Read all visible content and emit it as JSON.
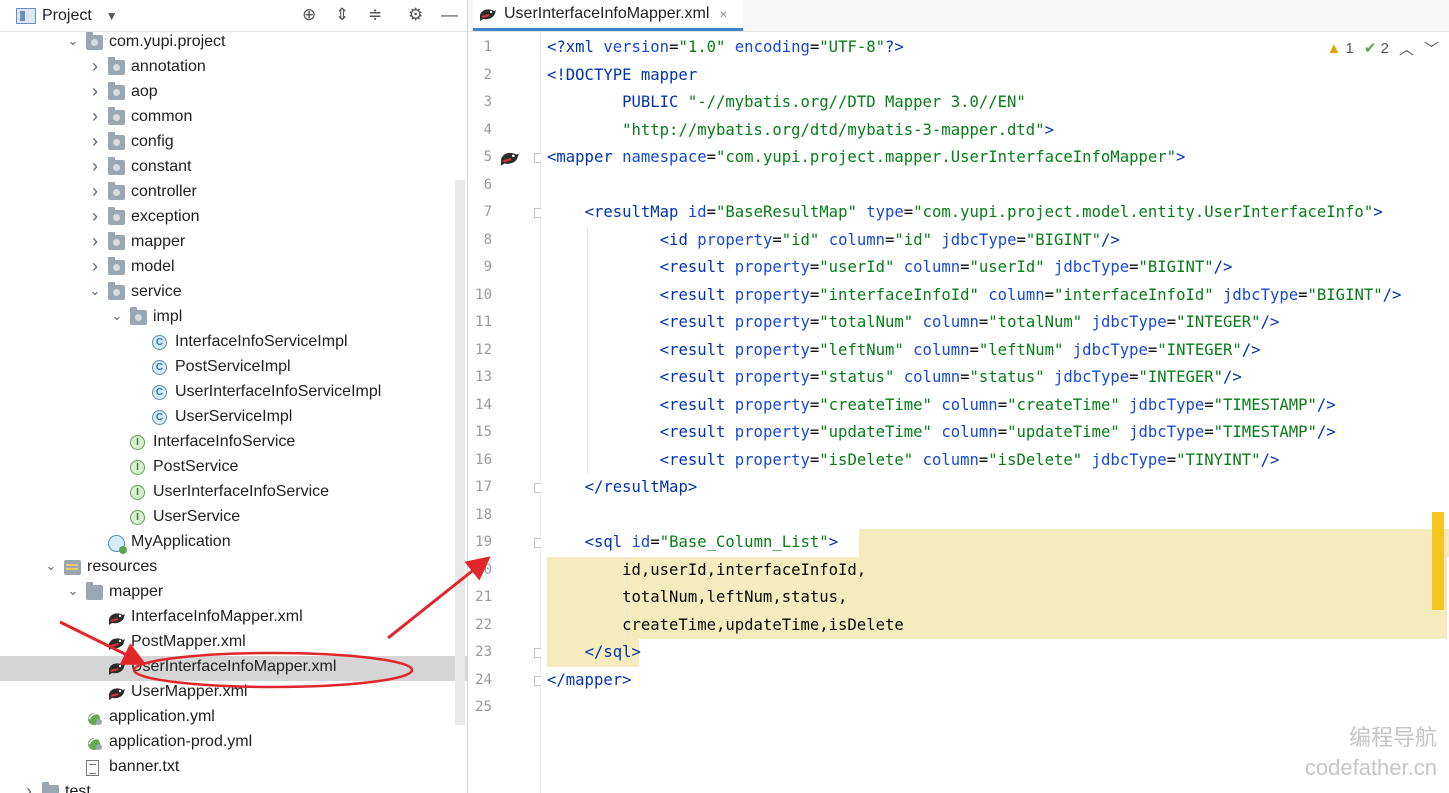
{
  "project_panel": {
    "title": "Project",
    "tree": [
      {
        "label": "com.yupi.project",
        "icon": "package-folder-icon",
        "arrow": "expanded",
        "depth": 4
      },
      {
        "label": "annotation",
        "icon": "package-folder-icon",
        "arrow": "collapsed",
        "depth": 5
      },
      {
        "label": "aop",
        "icon": "package-folder-icon",
        "arrow": "collapsed",
        "depth": 5
      },
      {
        "label": "common",
        "icon": "package-folder-icon",
        "arrow": "collapsed",
        "depth": 5
      },
      {
        "label": "config",
        "icon": "package-folder-icon",
        "arrow": "collapsed",
        "depth": 5
      },
      {
        "label": "constant",
        "icon": "package-folder-icon",
        "arrow": "collapsed",
        "depth": 5
      },
      {
        "label": "controller",
        "icon": "package-folder-icon",
        "arrow": "collapsed",
        "depth": 5
      },
      {
        "label": "exception",
        "icon": "package-folder-icon",
        "arrow": "collapsed",
        "depth": 5
      },
      {
        "label": "mapper",
        "icon": "package-folder-icon",
        "arrow": "collapsed",
        "depth": 5
      },
      {
        "label": "model",
        "icon": "package-folder-icon",
        "arrow": "collapsed",
        "depth": 5
      },
      {
        "label": "service",
        "icon": "package-folder-icon",
        "arrow": "expanded",
        "depth": 5
      },
      {
        "label": "impl",
        "icon": "package-folder-icon",
        "arrow": "expanded",
        "depth": 6
      },
      {
        "label": "InterfaceInfoServiceImpl",
        "icon": "class-icon",
        "arrow": "",
        "depth": 7
      },
      {
        "label": "PostServiceImpl",
        "icon": "class-icon",
        "arrow": "",
        "depth": 7
      },
      {
        "label": "UserInterfaceInfoServiceImpl",
        "icon": "class-icon",
        "arrow": "",
        "depth": 7
      },
      {
        "label": "UserServiceImpl",
        "icon": "class-icon",
        "arrow": "",
        "depth": 7
      },
      {
        "label": "InterfaceInfoService",
        "icon": "interface-icon",
        "arrow": "",
        "depth": 6
      },
      {
        "label": "PostService",
        "icon": "interface-icon",
        "arrow": "",
        "depth": 6
      },
      {
        "label": "UserInterfaceInfoService",
        "icon": "interface-icon",
        "arrow": "",
        "depth": 6
      },
      {
        "label": "UserService",
        "icon": "interface-icon",
        "arrow": "",
        "depth": 6
      },
      {
        "label": "MyApplication",
        "icon": "spring-app-icon",
        "arrow": "",
        "depth": 5
      },
      {
        "label": "resources",
        "icon": "resources-folder-icon",
        "arrow": "expanded",
        "depth": 3
      },
      {
        "label": "mapper",
        "icon": "folder-icon",
        "arrow": "expanded",
        "depth": 4
      },
      {
        "label": "InterfaceInfoMapper.xml",
        "icon": "mybatis-xml-icon",
        "arrow": "",
        "depth": 5
      },
      {
        "label": "PostMapper.xml",
        "icon": "mybatis-xml-icon",
        "arrow": "",
        "depth": 5
      },
      {
        "label": "UserInterfaceInfoMapper.xml",
        "icon": "mybatis-xml-icon",
        "arrow": "",
        "depth": 5,
        "selected": true
      },
      {
        "label": "UserMapper.xml",
        "icon": "mybatis-xml-icon",
        "arrow": "",
        "depth": 5
      },
      {
        "label": "application.yml",
        "icon": "yaml-config-icon",
        "arrow": "",
        "depth": 4
      },
      {
        "label": "application-prod.yml",
        "icon": "yaml-config-icon",
        "arrow": "",
        "depth": 4
      },
      {
        "label": "banner.txt",
        "icon": "text-file-icon",
        "arrow": "",
        "depth": 4
      },
      {
        "label": "test",
        "icon": "folder-icon",
        "arrow": "collapsed",
        "depth": 2
      }
    ]
  },
  "editor": {
    "tab_label": "UserInterfaceInfoMapper.xml",
    "tab_close": "×",
    "inspections": {
      "warnings": "1",
      "checks": "2"
    },
    "lines": [
      [
        [
          "pi",
          "<?"
        ],
        [
          "tag",
          "xml "
        ],
        [
          "attr",
          "version"
        ],
        [
          "plain",
          "="
        ],
        [
          "str",
          "\"1.0\""
        ],
        [
          "plain",
          " "
        ],
        [
          "attr",
          "encoding"
        ],
        [
          "plain",
          "="
        ],
        [
          "str",
          "\"UTF-8\""
        ],
        [
          "pi",
          "?>"
        ]
      ],
      [
        [
          "tag",
          "<!DOCTYPE mapper"
        ]
      ],
      [
        [
          "plain",
          "        "
        ],
        [
          "tag",
          "PUBLIC "
        ],
        [
          "str",
          "\"-//mybatis.org//DTD Mapper 3.0//EN\""
        ]
      ],
      [
        [
          "plain",
          "        "
        ],
        [
          "str",
          "\"http://mybatis.org/dtd/mybatis-3-mapper.dtd\""
        ],
        [
          "tag",
          ">"
        ]
      ],
      [
        [
          "tag",
          "<mapper "
        ],
        [
          "attr",
          "namespace"
        ],
        [
          "plain",
          "="
        ],
        [
          "str",
          "\"com.yupi.project.mapper.UserInterfaceInfoMapper\""
        ],
        [
          "tag",
          ">"
        ]
      ],
      [
        [
          "plain",
          ""
        ]
      ],
      [
        [
          "plain",
          "    "
        ],
        [
          "tag",
          "<resultMap "
        ],
        [
          "attr",
          "id"
        ],
        [
          "plain",
          "="
        ],
        [
          "str",
          "\"BaseResultMap\""
        ],
        [
          "plain",
          " "
        ],
        [
          "attr",
          "type"
        ],
        [
          "plain",
          "="
        ],
        [
          "str",
          "\"com.yupi.project.model.entity.UserInterfaceInfo\""
        ],
        [
          "tag",
          ">"
        ]
      ],
      [
        [
          "plain",
          "            "
        ],
        [
          "tag",
          "<id "
        ],
        [
          "attr",
          "property"
        ],
        [
          "plain",
          "="
        ],
        [
          "str",
          "\"id\""
        ],
        [
          "plain",
          " "
        ],
        [
          "attr",
          "column"
        ],
        [
          "plain",
          "="
        ],
        [
          "str",
          "\"id\""
        ],
        [
          "plain",
          " "
        ],
        [
          "attr",
          "jdbcType"
        ],
        [
          "plain",
          "="
        ],
        [
          "str",
          "\"BIGINT\""
        ],
        [
          "tag",
          "/>"
        ]
      ],
      [
        [
          "plain",
          "            "
        ],
        [
          "tag",
          "<result "
        ],
        [
          "attr",
          "property"
        ],
        [
          "plain",
          "="
        ],
        [
          "str",
          "\"userId\""
        ],
        [
          "plain",
          " "
        ],
        [
          "attr",
          "column"
        ],
        [
          "plain",
          "="
        ],
        [
          "str",
          "\"userId\""
        ],
        [
          "plain",
          " "
        ],
        [
          "attr",
          "jdbcType"
        ],
        [
          "plain",
          "="
        ],
        [
          "str",
          "\"BIGINT\""
        ],
        [
          "tag",
          "/>"
        ]
      ],
      [
        [
          "plain",
          "            "
        ],
        [
          "tag",
          "<result "
        ],
        [
          "attr",
          "property"
        ],
        [
          "plain",
          "="
        ],
        [
          "str",
          "\"interfaceInfoId\""
        ],
        [
          "plain",
          " "
        ],
        [
          "attr",
          "column"
        ],
        [
          "plain",
          "="
        ],
        [
          "str",
          "\"interfaceInfoId\""
        ],
        [
          "plain",
          " "
        ],
        [
          "attr",
          "jdbcType"
        ],
        [
          "plain",
          "="
        ],
        [
          "str",
          "\"BIGINT\""
        ],
        [
          "tag",
          "/>"
        ]
      ],
      [
        [
          "plain",
          "            "
        ],
        [
          "tag",
          "<result "
        ],
        [
          "attr",
          "property"
        ],
        [
          "plain",
          "="
        ],
        [
          "str",
          "\"totalNum\""
        ],
        [
          "plain",
          " "
        ],
        [
          "attr",
          "column"
        ],
        [
          "plain",
          "="
        ],
        [
          "str",
          "\"totalNum\""
        ],
        [
          "plain",
          " "
        ],
        [
          "attr",
          "jdbcType"
        ],
        [
          "plain",
          "="
        ],
        [
          "str",
          "\"INTEGER\""
        ],
        [
          "tag",
          "/>"
        ]
      ],
      [
        [
          "plain",
          "            "
        ],
        [
          "tag",
          "<result "
        ],
        [
          "attr",
          "property"
        ],
        [
          "plain",
          "="
        ],
        [
          "str",
          "\"leftNum\""
        ],
        [
          "plain",
          " "
        ],
        [
          "attr",
          "column"
        ],
        [
          "plain",
          "="
        ],
        [
          "str",
          "\"leftNum\""
        ],
        [
          "plain",
          " "
        ],
        [
          "attr",
          "jdbcType"
        ],
        [
          "plain",
          "="
        ],
        [
          "str",
          "\"INTEGER\""
        ],
        [
          "tag",
          "/>"
        ]
      ],
      [
        [
          "plain",
          "            "
        ],
        [
          "tag",
          "<result "
        ],
        [
          "attr",
          "property"
        ],
        [
          "plain",
          "="
        ],
        [
          "str",
          "\"status\""
        ],
        [
          "plain",
          " "
        ],
        [
          "attr",
          "column"
        ],
        [
          "plain",
          "="
        ],
        [
          "str",
          "\"status\""
        ],
        [
          "plain",
          " "
        ],
        [
          "attr",
          "jdbcType"
        ],
        [
          "plain",
          "="
        ],
        [
          "str",
          "\"INTEGER\""
        ],
        [
          "tag",
          "/>"
        ]
      ],
      [
        [
          "plain",
          "            "
        ],
        [
          "tag",
          "<result "
        ],
        [
          "attr",
          "property"
        ],
        [
          "plain",
          "="
        ],
        [
          "str",
          "\"createTime\""
        ],
        [
          "plain",
          " "
        ],
        [
          "attr",
          "column"
        ],
        [
          "plain",
          "="
        ],
        [
          "str",
          "\"createTime\""
        ],
        [
          "plain",
          " "
        ],
        [
          "attr",
          "jdbcType"
        ],
        [
          "plain",
          "="
        ],
        [
          "str",
          "\"TIMESTAMP\""
        ],
        [
          "tag",
          "/>"
        ]
      ],
      [
        [
          "plain",
          "            "
        ],
        [
          "tag",
          "<result "
        ],
        [
          "attr",
          "property"
        ],
        [
          "plain",
          "="
        ],
        [
          "str",
          "\"updateTime\""
        ],
        [
          "plain",
          " "
        ],
        [
          "attr",
          "column"
        ],
        [
          "plain",
          "="
        ],
        [
          "str",
          "\"updateTime\""
        ],
        [
          "plain",
          " "
        ],
        [
          "attr",
          "jdbcType"
        ],
        [
          "plain",
          "="
        ],
        [
          "str",
          "\"TIMESTAMP\""
        ],
        [
          "tag",
          "/>"
        ]
      ],
      [
        [
          "plain",
          "            "
        ],
        [
          "tag",
          "<result "
        ],
        [
          "attr",
          "property"
        ],
        [
          "plain",
          "="
        ],
        [
          "str",
          "\"isDelete\""
        ],
        [
          "plain",
          " "
        ],
        [
          "attr",
          "column"
        ],
        [
          "plain",
          "="
        ],
        [
          "str",
          "\"isDelete\""
        ],
        [
          "plain",
          " "
        ],
        [
          "attr",
          "jdbcType"
        ],
        [
          "plain",
          "="
        ],
        [
          "str",
          "\"TINYINT\""
        ],
        [
          "tag",
          "/>"
        ]
      ],
      [
        [
          "plain",
          "    "
        ],
        [
          "tag",
          "</resultMap>"
        ]
      ],
      [
        [
          "plain",
          ""
        ]
      ],
      [
        [
          "plain",
          "    "
        ],
        [
          "tag",
          "<sql "
        ],
        [
          "attr",
          "id"
        ],
        [
          "plain",
          "="
        ],
        [
          "str",
          "\"Base_Column_List\""
        ],
        [
          "tag",
          ">"
        ]
      ],
      [
        [
          "plain",
          "        id,userId,interfaceInfoId,"
        ]
      ],
      [
        [
          "plain",
          "        totalNum,leftNum,status,"
        ]
      ],
      [
        [
          "plain",
          "        createTime,updateTime,isDelete"
        ]
      ],
      [
        [
          "plain",
          "    "
        ],
        [
          "tag",
          "</sql>"
        ]
      ],
      [
        [
          "tag",
          "</mapper>"
        ]
      ],
      [
        [
          "plain",
          ""
        ]
      ]
    ]
  },
  "watermark": {
    "line1": "编程导航",
    "line2": "codefather.cn"
  },
  "colors": {
    "annotation_red": "#e0262a",
    "selection": "#d5d5d5",
    "sql_highlight": "#f6ebbd"
  }
}
